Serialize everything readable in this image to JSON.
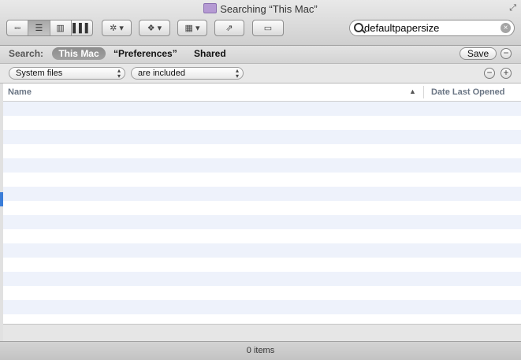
{
  "window": {
    "title": "Searching “This Mac”"
  },
  "toolbar": {
    "view_buttons": [
      {
        "name": "icon-view",
        "icon": "grid-icon",
        "glyph": "▫▫",
        "active": false
      },
      {
        "name": "list-view",
        "icon": "list-icon",
        "glyph": "☰",
        "active": true
      },
      {
        "name": "column-view",
        "icon": "columns-icon",
        "glyph": "▥",
        "active": false
      },
      {
        "name": "coverflow-view",
        "icon": "coverflow-icon",
        "glyph": "▌▌▌",
        "active": false
      }
    ],
    "action_glyph": "✲ ▾",
    "dropbox_glyph": "❖ ▾",
    "arrange_glyph": "▦ ▾",
    "share_glyph": "⇗",
    "tag_glyph": "▭"
  },
  "search": {
    "value": "defaultpapersize",
    "clear_glyph": "×"
  },
  "scope": {
    "label": "Search:",
    "options": [
      "This Mac",
      "“Preferences”",
      "Shared"
    ],
    "selected": "This Mac",
    "save_label": "Save",
    "remove_glyph": "−"
  },
  "criteria": {
    "attribute": "System files",
    "operator": "are included",
    "remove_glyph": "−",
    "add_glyph": "+"
  },
  "table": {
    "columns": [
      "Name",
      "Date Last Opened"
    ],
    "sort_glyph": "▲",
    "rows": []
  },
  "status": {
    "count_text": "0 items"
  }
}
